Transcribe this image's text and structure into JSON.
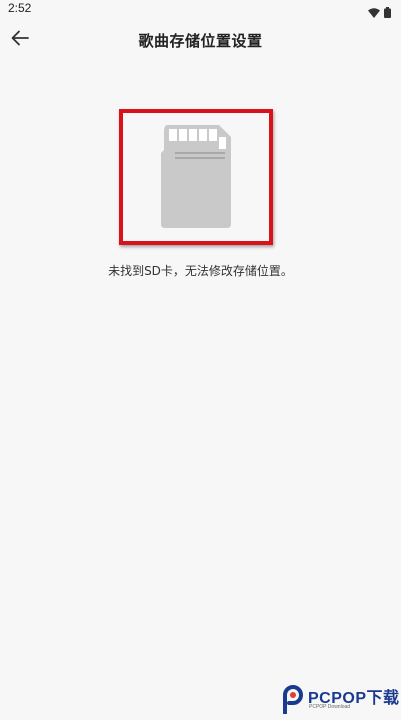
{
  "status_bar": {
    "time": "2:52",
    "icons": [
      "wifi-icon",
      "battery-icon"
    ]
  },
  "app_bar": {
    "back_icon": "arrow-left-icon",
    "title": "歌曲存储位置设置"
  },
  "main": {
    "illustration": "sd-card-icon",
    "highlight_color": "#d9111a",
    "message": "未找到SD卡，无法修改存储位置。"
  },
  "watermark": {
    "brand": "PCPOP下载",
    "sub": "PCPOP Download"
  },
  "colors": {
    "background": "#f7f7f8",
    "card_gray": "#c9c9c9",
    "brand_blue": "#1a3a8f"
  }
}
